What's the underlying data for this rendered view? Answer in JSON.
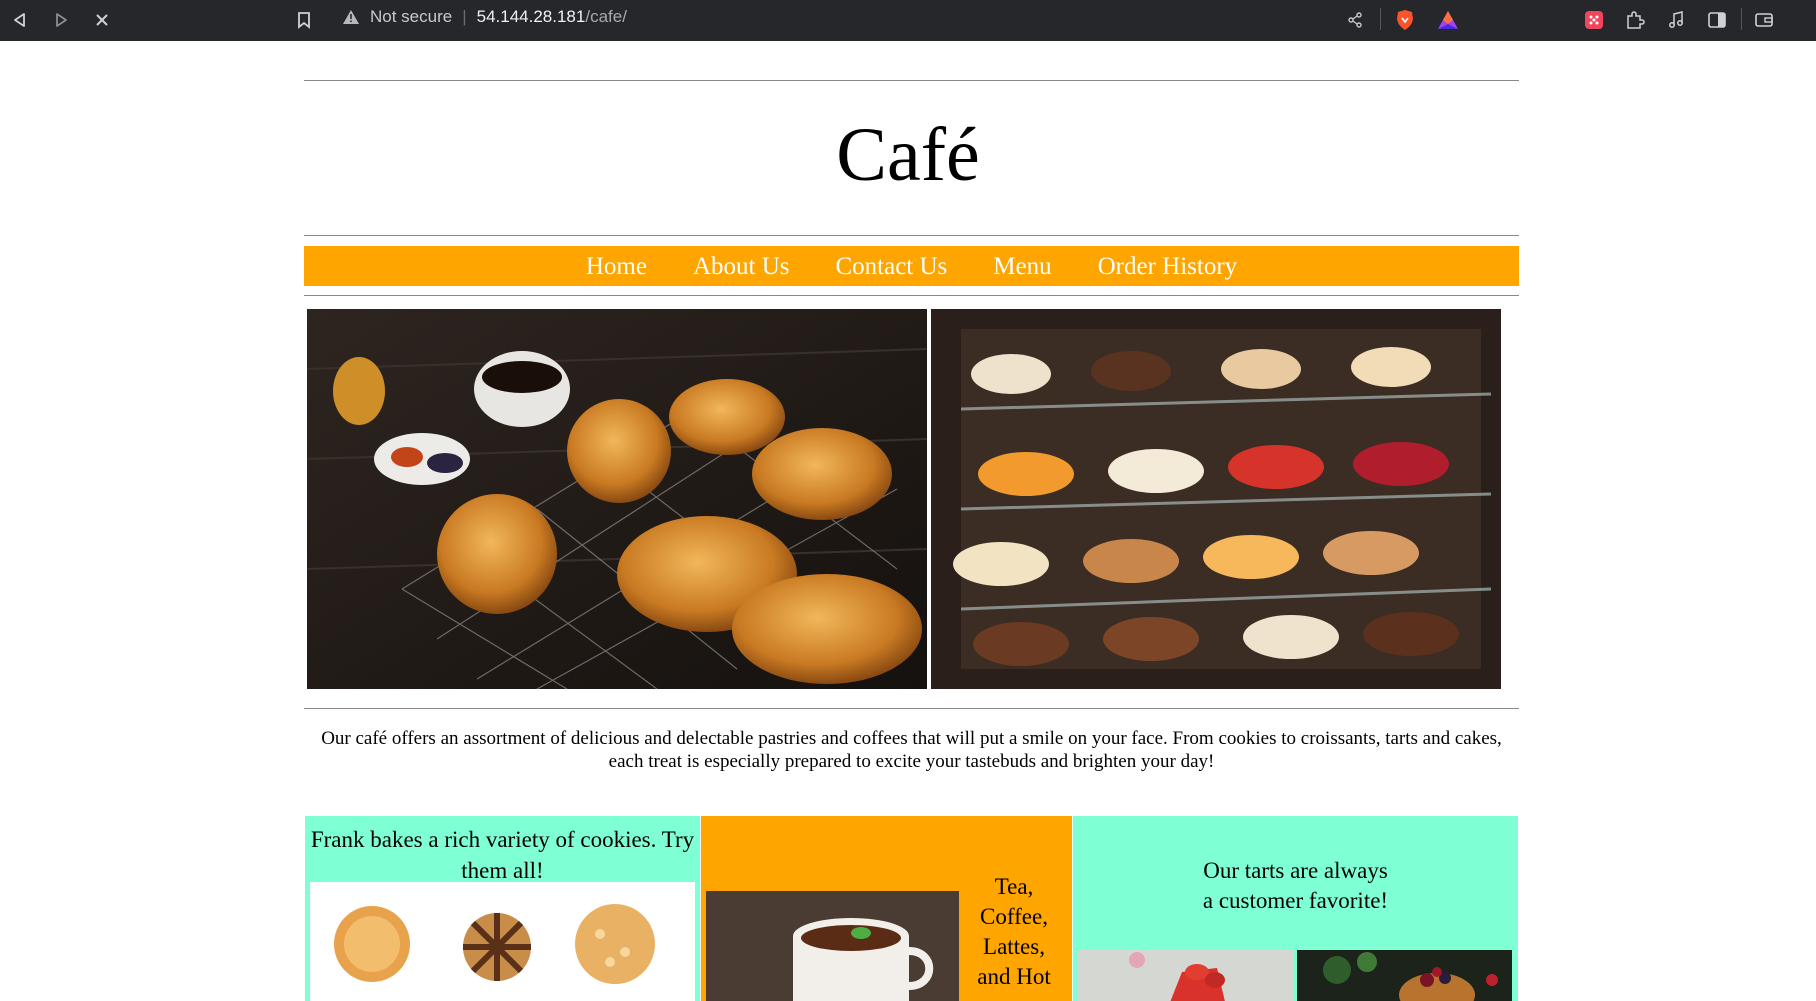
{
  "browser": {
    "security_label": "Not secure",
    "url_host": "54.144.28.181",
    "url_path": "/cafe/",
    "icons": [
      "back-icon",
      "forward-icon",
      "stop-icon",
      "bookmark-icon",
      "warning-icon",
      "share-icon",
      "brave-shield-icon",
      "brave-rewards-icon",
      "extension-icon",
      "puzzle-icon",
      "music-icon",
      "sidebar-icon",
      "wallet-icon"
    ]
  },
  "site": {
    "title": "Café",
    "nav": [
      "Home",
      "About Us",
      "Contact Us",
      "Menu",
      "Order History"
    ],
    "intro_line1": "Our café offers an assortment of delicious and delectable pastries and coffees that will put a smile on your face. From cookies to croissants, tarts and cakes,",
    "intro_line2": "each treat is especially prepared to excite your tastebuds and brighten your day!",
    "cards": {
      "cookies_line1": "Frank bakes a rich variety of cookies. Try",
      "cookies_line2": "them all!",
      "drinks_lines": [
        "Tea,",
        "Coffee,",
        "Lattes,",
        "and Hot"
      ],
      "tarts_line1": "Our tarts are always",
      "tarts_line2": "a customer favorite!"
    }
  },
  "colors": {
    "nav_bg": "#ffa500",
    "card_aqua": "#7fffd4",
    "card_orange": "#ffa500",
    "chrome_bg": "#26272b"
  }
}
